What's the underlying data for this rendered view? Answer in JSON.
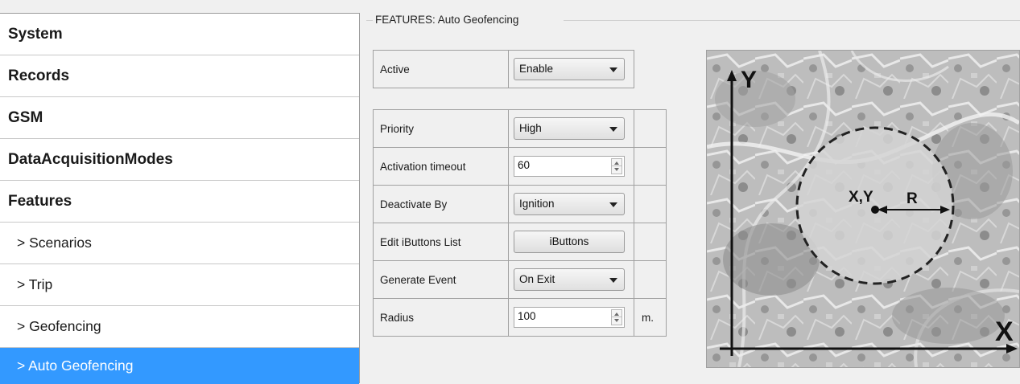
{
  "sidebar": {
    "items": [
      {
        "label": "System"
      },
      {
        "label": "Records"
      },
      {
        "label": "GSM"
      },
      {
        "label": "DataAcquisitionModes"
      },
      {
        "label": "Features"
      },
      {
        "label": "> Scenarios"
      },
      {
        "label": "> Trip"
      },
      {
        "label": "> Geofencing"
      },
      {
        "label": "> Auto Geofencing"
      }
    ],
    "selected_color": "#3399ff"
  },
  "group": {
    "title": "FEATURES: Auto Geofencing"
  },
  "settings": {
    "active": {
      "label": "Active",
      "value": "Enable"
    },
    "priority": {
      "label": "Priority",
      "value": "High"
    },
    "activation_timeout": {
      "label": "Activation timeout",
      "value": "60"
    },
    "deactivate_by": {
      "label": "Deactivate By",
      "value": "Ignition"
    },
    "edit_ibuttons": {
      "label": "Edit iButtons List",
      "button": "iButtons"
    },
    "generate_event": {
      "label": "Generate Event",
      "value": "On Exit"
    },
    "radius": {
      "label": "Radius",
      "value": "100",
      "unit": "m."
    }
  },
  "diagram": {
    "y_axis": "Y",
    "x_axis": "X",
    "center_label": "X,Y",
    "radius_label": "R"
  }
}
